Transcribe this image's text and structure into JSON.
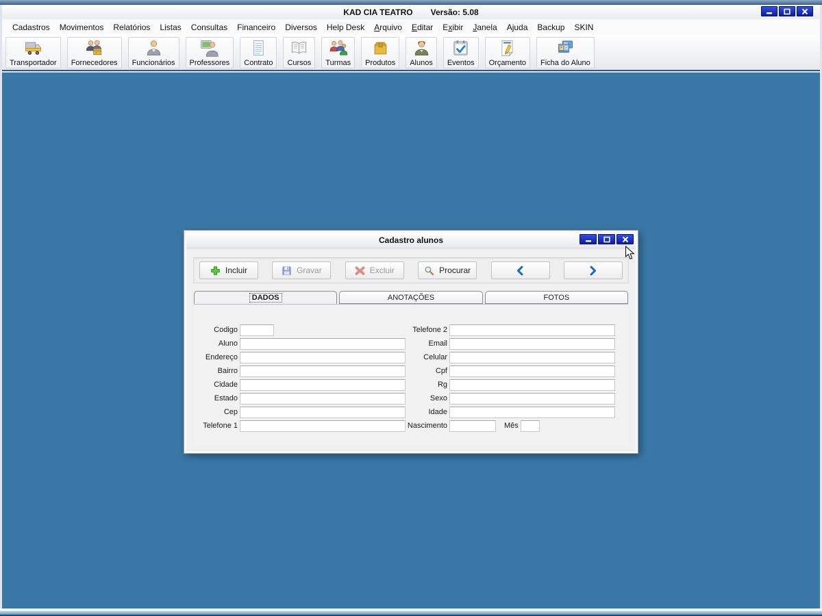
{
  "window": {
    "title": "KAD CIA TEATRO",
    "version": "Versão: 5.08",
    "controls": [
      {
        "name": "minimize-button",
        "icon": "minimize-icon"
      },
      {
        "name": "maximize-button",
        "icon": "maximize-icon"
      },
      {
        "name": "close-button",
        "icon": "close-icon"
      }
    ]
  },
  "menu": {
    "items": [
      {
        "label": "Cadastros"
      },
      {
        "label": "Movimentos"
      },
      {
        "label": "Relatórios"
      },
      {
        "label": "Listas"
      },
      {
        "label": "Consultas"
      },
      {
        "label": "Financeiro"
      },
      {
        "label": "Diversos"
      },
      {
        "label": "Help Desk"
      },
      {
        "label": "Arquivo",
        "accel": 0
      },
      {
        "label": "Editar",
        "accel": 0
      },
      {
        "label": "Exibir",
        "accel": 1
      },
      {
        "label": "Janela",
        "accel": 0
      },
      {
        "label": "Ajuda"
      },
      {
        "label": "Backup"
      },
      {
        "label": "SKIN"
      }
    ]
  },
  "toolbar": {
    "items": [
      {
        "label": "Transportador",
        "icon": "truck-icon"
      },
      {
        "label": "Fornecedores",
        "icon": "suppliers-icon"
      },
      {
        "label": "Funcionários",
        "icon": "employee-icon"
      },
      {
        "label": "Professores",
        "icon": "professor-icon"
      },
      {
        "label": "Contrato",
        "icon": "contract-icon"
      },
      {
        "label": "Cursos",
        "icon": "book-icon"
      },
      {
        "label": "Turmas",
        "icon": "group-icon"
      },
      {
        "label": "Produtos",
        "icon": "box-icon"
      },
      {
        "label": "Alunos",
        "icon": "student-icon"
      },
      {
        "label": "Eventos",
        "icon": "calendar-check-icon"
      },
      {
        "label": "Orçamento",
        "icon": "pencil-paper-icon"
      },
      {
        "label": "Ficha do Aluno",
        "icon": "record-cards-icon"
      }
    ]
  },
  "dialog": {
    "title": "Cadastro alunos",
    "controls": [
      {
        "name": "minimize-button",
        "icon": "minimize-icon"
      },
      {
        "name": "maximize-button",
        "icon": "maximize-icon"
      },
      {
        "name": "close-button",
        "icon": "close-icon"
      }
    ],
    "actions": [
      {
        "label": "Incluir",
        "icon": "plus-icon",
        "enabled": true
      },
      {
        "label": "Gravar",
        "icon": "save-icon",
        "enabled": false
      },
      {
        "label": "Excluir",
        "icon": "delete-icon",
        "enabled": false
      },
      {
        "label": "Procurar",
        "icon": "search-icon",
        "enabled": true
      },
      {
        "label": "",
        "icon": "chevron-left-icon",
        "enabled": true,
        "name": "previous-record-button"
      },
      {
        "label": "",
        "icon": "chevron-right-icon",
        "enabled": true,
        "name": "next-record-button"
      }
    ],
    "tabs": [
      {
        "label": "DADOS",
        "active": true
      },
      {
        "label": "ANOTAÇÕES",
        "active": false
      },
      {
        "label": "FOTOS",
        "active": false
      }
    ],
    "form": {
      "left": [
        {
          "label": "Codigo",
          "value": "",
          "size": "small"
        },
        {
          "label": "Aluno",
          "value": "",
          "size": "normal"
        },
        {
          "label": "Endereço",
          "value": "",
          "size": "normal"
        },
        {
          "label": "Bairro",
          "value": "",
          "size": "normal"
        },
        {
          "label": "Cidade",
          "value": "",
          "size": "normal"
        },
        {
          "label": "Estado",
          "value": "",
          "size": "normal"
        },
        {
          "label": "Cep",
          "value": "",
          "size": "normal"
        },
        {
          "label": "Telefone 1",
          "value": "",
          "size": "normal"
        }
      ],
      "right": [
        {
          "label": "Telefone 2",
          "value": "",
          "size": "normal"
        },
        {
          "label": "Email",
          "value": "",
          "size": "normal"
        },
        {
          "label": "Celular",
          "value": "",
          "size": "normal"
        },
        {
          "label": "Cpf",
          "value": "",
          "size": "normal"
        },
        {
          "label": "Rg",
          "value": "",
          "size": "normal"
        },
        {
          "label": "Sexo",
          "value": "",
          "size": "normal"
        },
        {
          "label": "Idade",
          "value": "",
          "size": "normal"
        },
        {
          "label": "Nascimento",
          "value": "",
          "size": "date",
          "extra": {
            "label": "Mês",
            "value": "",
            "size": "tiny"
          }
        }
      ]
    }
  },
  "colors": {
    "desktop_blue": "#3a77a6",
    "control_button_blue": "#1228c0",
    "accent_blue": "#1868c0"
  }
}
